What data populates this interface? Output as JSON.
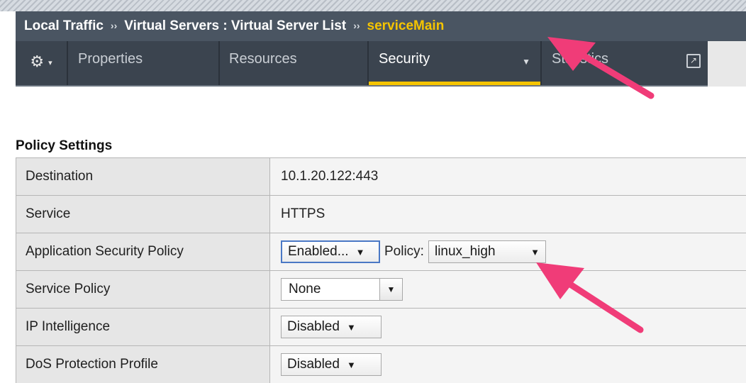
{
  "breadcrumb": {
    "items": [
      "Local Traffic",
      "Virtual Servers : Virtual Server List"
    ],
    "current": "serviceMain",
    "separator": "››"
  },
  "tabs": {
    "gear_icon": "⚙",
    "gear_caret": "▾",
    "properties": "Properties",
    "resources": "Resources",
    "security": "Security",
    "security_caret": "▼",
    "statistics": "Statistics",
    "external_icon": "↗"
  },
  "section": {
    "title": "Policy Settings"
  },
  "rows": {
    "destination": {
      "label": "Destination",
      "value": "10.1.20.122:443"
    },
    "service": {
      "label": "Service",
      "value": "HTTPS"
    },
    "asp": {
      "label": "Application Security Policy",
      "state": "Enabled...",
      "policy_label": "Policy:",
      "policy_value": "linux_high"
    },
    "service_policy": {
      "label": "Service Policy",
      "value": "None"
    },
    "ip_intelligence": {
      "label": "IP Intelligence",
      "value": "Disabled"
    },
    "dos": {
      "label": "DoS Protection Profile",
      "value": "Disabled"
    }
  },
  "icons": {
    "dropdown_arrow": "▼"
  },
  "colors": {
    "accent": "#f5c400",
    "header_bg": "#4a5562",
    "tab_bg": "#3b444f",
    "annotation": "#f03c78"
  }
}
